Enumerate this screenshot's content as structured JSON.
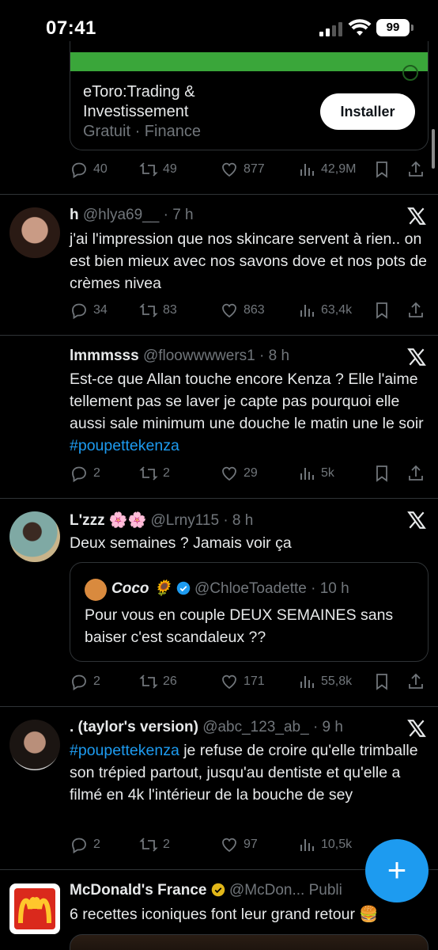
{
  "status_bar": {
    "time": "07:41",
    "battery": "99"
  },
  "ad": {
    "title_line1": "eToro:Trading &",
    "title_line2": "Investissement",
    "subtitle": "Gratuit · Finance",
    "install_label": "Installer",
    "stats": {
      "replies": "40",
      "reposts": "49",
      "likes": "877",
      "views": "42,9M"
    },
    "image_color": "#3aa63a"
  },
  "tweets": [
    {
      "name": "h",
      "handle": "@hlya69__",
      "time": "· 7 h",
      "text": "j'ai l'impression que nos skincare servent à rien..  on est bien mieux avec nos savons dove et nos pots de crèmes nivea",
      "stats": {
        "replies": "34",
        "reposts": "83",
        "likes": "863",
        "views": "63,4k"
      }
    },
    {
      "name": "lmmmsss",
      "handle": "@floowwwwers1",
      "time": "· 8 h",
      "text": "Est-ce que Allan touche encore Kenza ? Elle l'aime tellement pas se laver je capte pas pourquoi elle aussi sale minimum une douche le matin une le soir ",
      "hashtag": "#poupettekenza",
      "stats": {
        "replies": "2",
        "reposts": "2",
        "likes": "29",
        "views": "5k"
      }
    },
    {
      "name": "L'zzz 🌸🌸",
      "handle": "@Lrny115",
      "time": "· 8 h",
      "text": "Deux semaines ? Jamais voir ça",
      "quote": {
        "name": "Coco 🌻",
        "handle": "@ChloeToadette",
        "time": "· 10 h",
        "text": "Pour vous en couple DEUX SEMAINES sans baiser c'est scandaleux ??"
      },
      "stats": {
        "replies": "2",
        "reposts": "26",
        "likes": "171",
        "views": "55,8k"
      }
    },
    {
      "name": ". (taylor's version)",
      "handle": "@abc_123_ab_",
      "time": "· 9 h",
      "hashtag": "#poupettekenza",
      "text": " je refuse de croire qu'elle trimballe son trépied partout, jusqu'au dentiste et qu'elle a filmé en 4k l'intérieur de la bouche de sey",
      "stats": {
        "replies": "2",
        "reposts": "2",
        "likes": "97",
        "views": "10,5k"
      }
    },
    {
      "name": "McDonald's France",
      "handle": "@McDon...",
      "label": "Publi",
      "text": "6 recettes iconiques font leur grand retour 🍔"
    }
  ],
  "fab": {
    "label": "+"
  },
  "colors": {
    "accent": "#1d9bf0",
    "background": "#000000",
    "muted": "#71767b",
    "divider": "#2f3336"
  }
}
